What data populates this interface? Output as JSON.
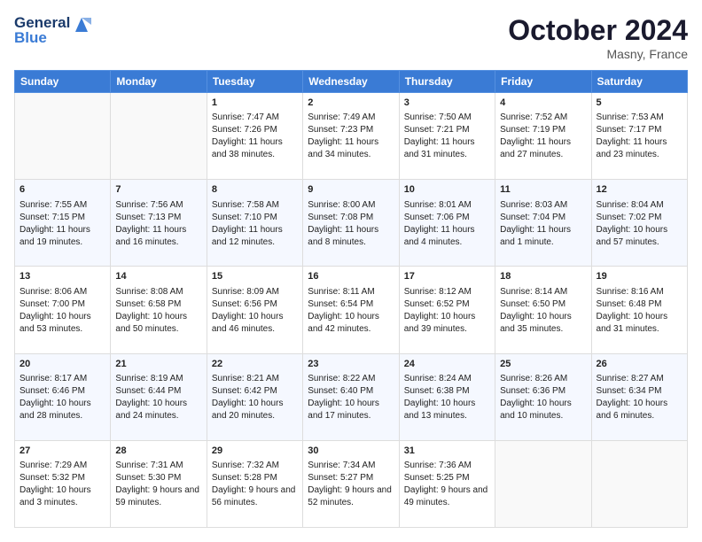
{
  "header": {
    "logo_line1": "General",
    "logo_line2": "Blue",
    "month": "October 2024",
    "location": "Masny, France"
  },
  "days_of_week": [
    "Sunday",
    "Monday",
    "Tuesday",
    "Wednesday",
    "Thursday",
    "Friday",
    "Saturday"
  ],
  "weeks": [
    [
      {
        "day": "",
        "content": ""
      },
      {
        "day": "",
        "content": ""
      },
      {
        "day": "1",
        "content": "Sunrise: 7:47 AM\nSunset: 7:26 PM\nDaylight: 11 hours and 38 minutes."
      },
      {
        "day": "2",
        "content": "Sunrise: 7:49 AM\nSunset: 7:23 PM\nDaylight: 11 hours and 34 minutes."
      },
      {
        "day": "3",
        "content": "Sunrise: 7:50 AM\nSunset: 7:21 PM\nDaylight: 11 hours and 31 minutes."
      },
      {
        "day": "4",
        "content": "Sunrise: 7:52 AM\nSunset: 7:19 PM\nDaylight: 11 hours and 27 minutes."
      },
      {
        "day": "5",
        "content": "Sunrise: 7:53 AM\nSunset: 7:17 PM\nDaylight: 11 hours and 23 minutes."
      }
    ],
    [
      {
        "day": "6",
        "content": "Sunrise: 7:55 AM\nSunset: 7:15 PM\nDaylight: 11 hours and 19 minutes."
      },
      {
        "day": "7",
        "content": "Sunrise: 7:56 AM\nSunset: 7:13 PM\nDaylight: 11 hours and 16 minutes."
      },
      {
        "day": "8",
        "content": "Sunrise: 7:58 AM\nSunset: 7:10 PM\nDaylight: 11 hours and 12 minutes."
      },
      {
        "day": "9",
        "content": "Sunrise: 8:00 AM\nSunset: 7:08 PM\nDaylight: 11 hours and 8 minutes."
      },
      {
        "day": "10",
        "content": "Sunrise: 8:01 AM\nSunset: 7:06 PM\nDaylight: 11 hours and 4 minutes."
      },
      {
        "day": "11",
        "content": "Sunrise: 8:03 AM\nSunset: 7:04 PM\nDaylight: 11 hours and 1 minute."
      },
      {
        "day": "12",
        "content": "Sunrise: 8:04 AM\nSunset: 7:02 PM\nDaylight: 10 hours and 57 minutes."
      }
    ],
    [
      {
        "day": "13",
        "content": "Sunrise: 8:06 AM\nSunset: 7:00 PM\nDaylight: 10 hours and 53 minutes."
      },
      {
        "day": "14",
        "content": "Sunrise: 8:08 AM\nSunset: 6:58 PM\nDaylight: 10 hours and 50 minutes."
      },
      {
        "day": "15",
        "content": "Sunrise: 8:09 AM\nSunset: 6:56 PM\nDaylight: 10 hours and 46 minutes."
      },
      {
        "day": "16",
        "content": "Sunrise: 8:11 AM\nSunset: 6:54 PM\nDaylight: 10 hours and 42 minutes."
      },
      {
        "day": "17",
        "content": "Sunrise: 8:12 AM\nSunset: 6:52 PM\nDaylight: 10 hours and 39 minutes."
      },
      {
        "day": "18",
        "content": "Sunrise: 8:14 AM\nSunset: 6:50 PM\nDaylight: 10 hours and 35 minutes."
      },
      {
        "day": "19",
        "content": "Sunrise: 8:16 AM\nSunset: 6:48 PM\nDaylight: 10 hours and 31 minutes."
      }
    ],
    [
      {
        "day": "20",
        "content": "Sunrise: 8:17 AM\nSunset: 6:46 PM\nDaylight: 10 hours and 28 minutes."
      },
      {
        "day": "21",
        "content": "Sunrise: 8:19 AM\nSunset: 6:44 PM\nDaylight: 10 hours and 24 minutes."
      },
      {
        "day": "22",
        "content": "Sunrise: 8:21 AM\nSunset: 6:42 PM\nDaylight: 10 hours and 20 minutes."
      },
      {
        "day": "23",
        "content": "Sunrise: 8:22 AM\nSunset: 6:40 PM\nDaylight: 10 hours and 17 minutes."
      },
      {
        "day": "24",
        "content": "Sunrise: 8:24 AM\nSunset: 6:38 PM\nDaylight: 10 hours and 13 minutes."
      },
      {
        "day": "25",
        "content": "Sunrise: 8:26 AM\nSunset: 6:36 PM\nDaylight: 10 hours and 10 minutes."
      },
      {
        "day": "26",
        "content": "Sunrise: 8:27 AM\nSunset: 6:34 PM\nDaylight: 10 hours and 6 minutes."
      }
    ],
    [
      {
        "day": "27",
        "content": "Sunrise: 7:29 AM\nSunset: 5:32 PM\nDaylight: 10 hours and 3 minutes."
      },
      {
        "day": "28",
        "content": "Sunrise: 7:31 AM\nSunset: 5:30 PM\nDaylight: 9 hours and 59 minutes."
      },
      {
        "day": "29",
        "content": "Sunrise: 7:32 AM\nSunset: 5:28 PM\nDaylight: 9 hours and 56 minutes."
      },
      {
        "day": "30",
        "content": "Sunrise: 7:34 AM\nSunset: 5:27 PM\nDaylight: 9 hours and 52 minutes."
      },
      {
        "day": "31",
        "content": "Sunrise: 7:36 AM\nSunset: 5:25 PM\nDaylight: 9 hours and 49 minutes."
      },
      {
        "day": "",
        "content": ""
      },
      {
        "day": "",
        "content": ""
      }
    ]
  ]
}
